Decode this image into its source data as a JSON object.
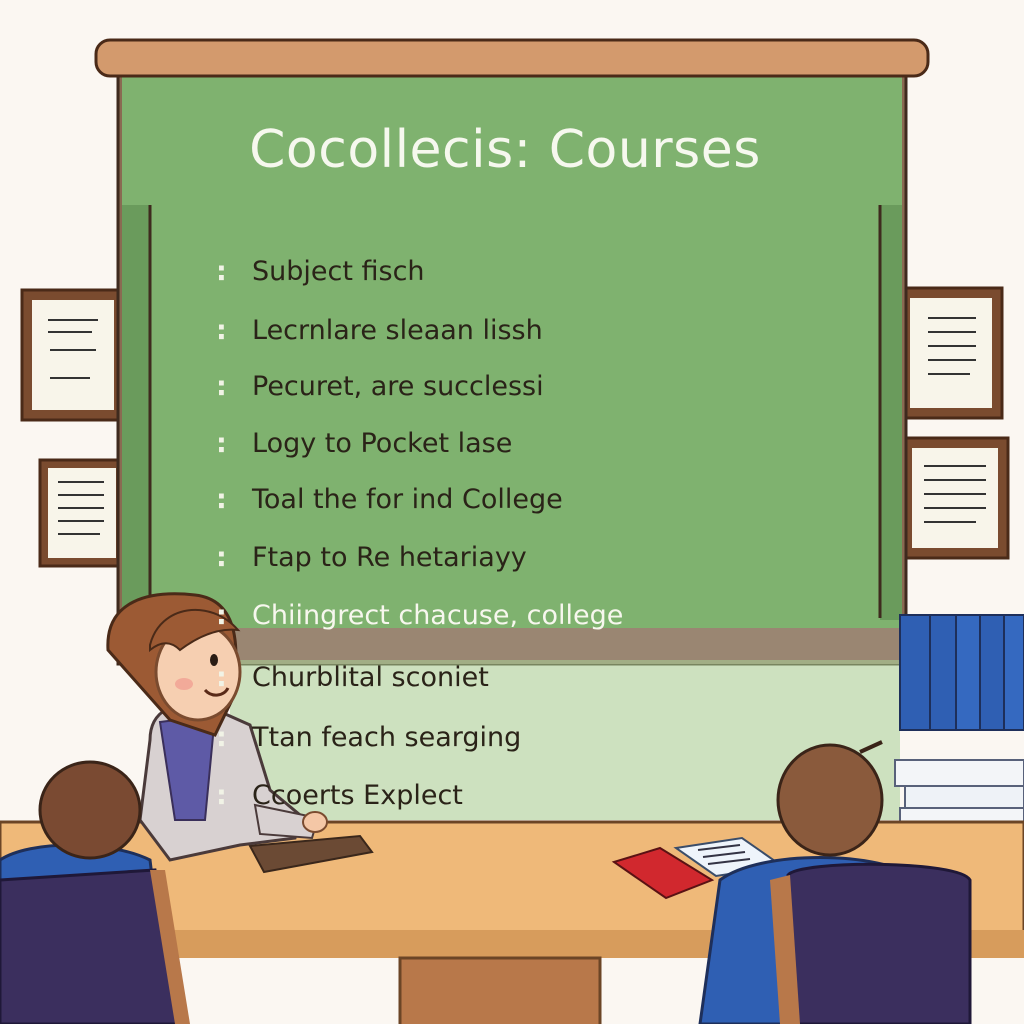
{
  "board": {
    "title": "Cocollecis: Courses",
    "items": [
      "Subject fisch",
      "Lecrnlare sleaan lissh",
      "Pecuret, are succlessi",
      "Logy to Pocket lase",
      "Toal the for ind College",
      "Ftap to Re hetariayy",
      "Chiingrect chacuse, college",
      "Churblital sconiet",
      "Ttan feach searging",
      "Ccoerts Explect"
    ],
    "bullet": ":"
  },
  "colors": {
    "board_green": "#7fb26f",
    "board_frame": "#d39a6d",
    "wall": "#fbf7f2",
    "table": "#efb979",
    "chair": "#3b2f5e",
    "books_blue": "#2f5fb3"
  }
}
